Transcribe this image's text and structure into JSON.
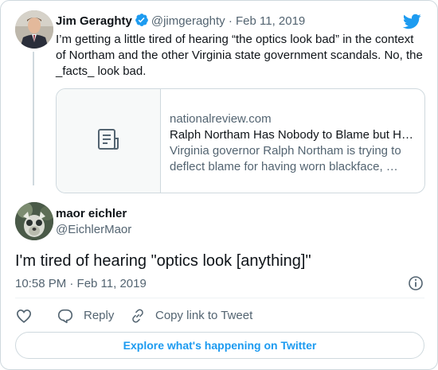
{
  "colors": {
    "accent": "#1d9bf0",
    "text_primary": "#0f1419",
    "text_secondary": "#536471",
    "border": "#cfd9de"
  },
  "parent_tweet": {
    "author_name": "Jim Geraghty",
    "verified": true,
    "handle": "@jimgeraghty",
    "separator": "·",
    "date": "Feb 11, 2019",
    "text": "I’m getting a little tired of hearing “the optics look bad” in the context of Northam and the other Virginia state government scandals. No, the _facts_ look bad.",
    "link_card": {
      "thumbnail_icon": "document-icon",
      "domain": "nationalreview.com",
      "title": "Ralph Northam Has Nobody to Blame but H…",
      "description_line1": "Virginia governor Ralph Northam is trying to",
      "description_line2": "deflect blame for having worn blackface, …"
    }
  },
  "main_tweet": {
    "author_name": "maor eichler",
    "handle": "@EichlerMaor",
    "text": "I'm tired of hearing \"optics look [anything]\"",
    "timestamp": "10:58 PM · Feb 11, 2019",
    "info_icon": "info-icon"
  },
  "actions": {
    "like_icon": "heart-icon",
    "reply_label": "Reply",
    "copy_link_label": "Copy link to Tweet"
  },
  "footer": {
    "explore_label": "Explore what's happening on Twitter"
  },
  "branding": {
    "logo_icon": "twitter-bird-icon"
  }
}
